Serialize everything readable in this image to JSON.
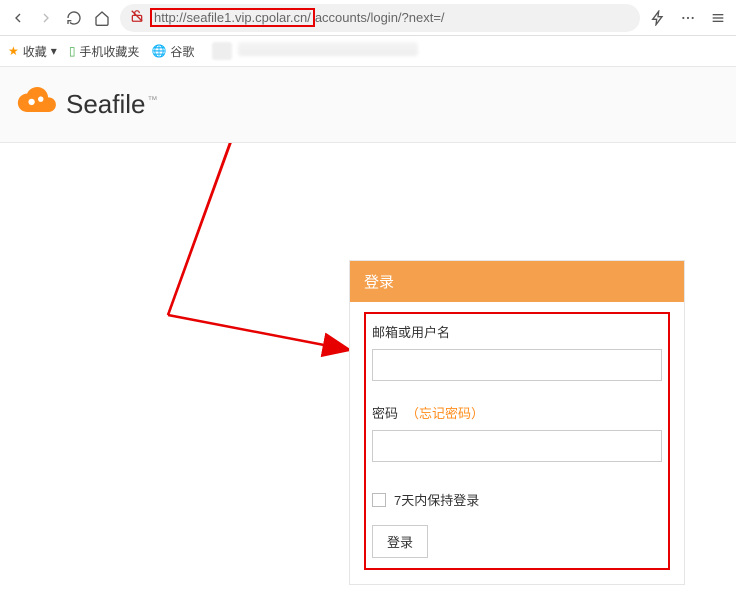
{
  "browser": {
    "url_highlighted": "http://seafile1.vip.cpolar.cn/",
    "url_remainder": "accounts/login/?next=/"
  },
  "bookmarks": {
    "favorites": "收藏",
    "mobile": "手机收藏夹",
    "google": "谷歌"
  },
  "brand": {
    "name_prefix": "Sea",
    "name_suffix": "file",
    "tm": "™"
  },
  "login": {
    "title": "登录",
    "user_label": "邮箱或用户名",
    "pass_label": "密码",
    "forgot": "（忘记密码）",
    "remember": "7天内保持登录",
    "submit": "登录"
  }
}
